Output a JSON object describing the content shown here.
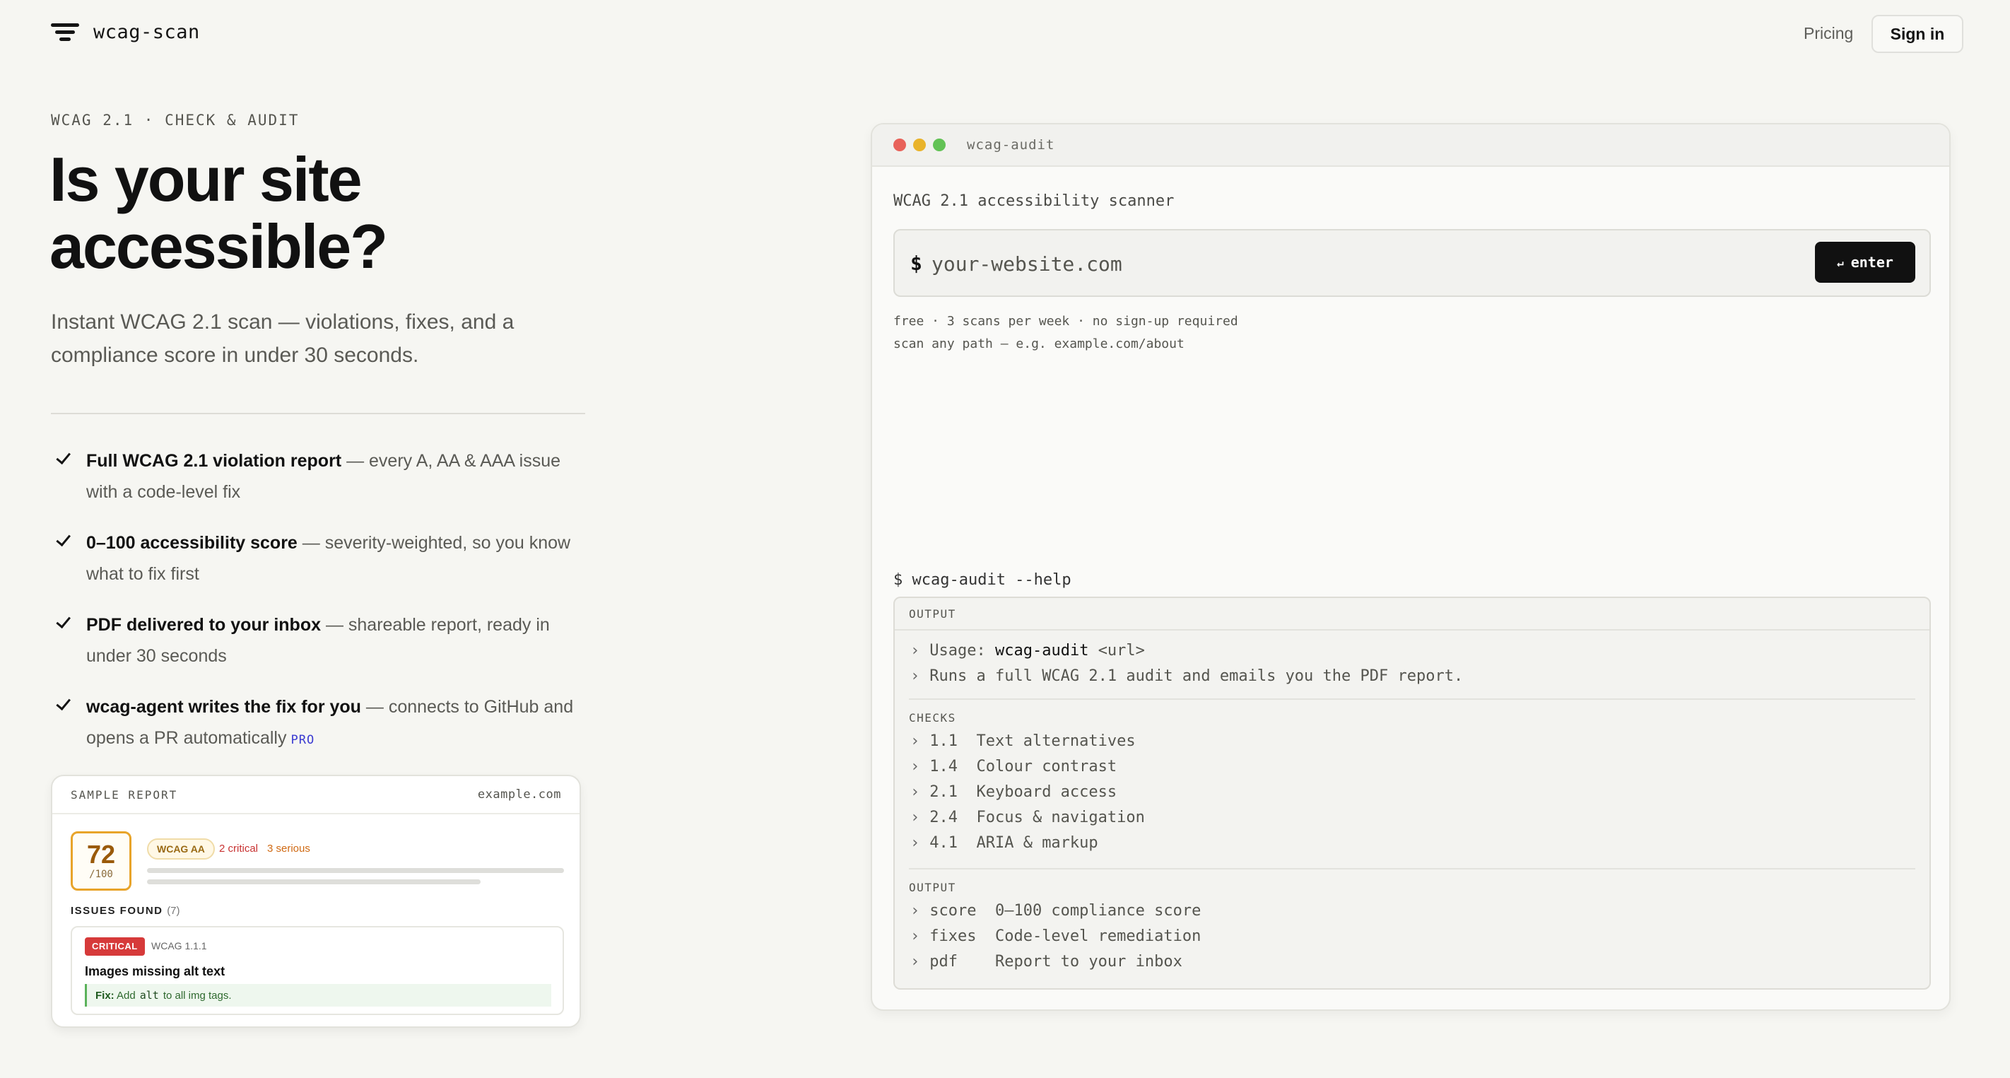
{
  "nav": {
    "brand": "wcag-scan",
    "pricing": "Pricing",
    "signin": "Sign in"
  },
  "hero": {
    "eyebrow": "WCAG 2.1 · CHECK & AUDIT",
    "title_line1": "Is your site",
    "title_line2": "accessible?",
    "subtitle": "Instant WCAG 2.1 scan — violations, fixes, and a compliance score in under 30 seconds."
  },
  "features": [
    {
      "bold": "Full WCAG 2.1 violation report",
      "rest": " — every A, AA & AAA issue with a code-level fix"
    },
    {
      "bold": "0–100 accessibility score",
      "rest": " — severity-weighted, so you know what to fix first"
    },
    {
      "bold": "PDF delivered to your inbox",
      "rest": " — shareable report, ready in under 30 seconds"
    },
    {
      "bold": "wcag-agent writes the fix for you",
      "rest": " — connects to GitHub and opens a PR automatically",
      "badge": "PRO"
    }
  ],
  "report": {
    "label": "SAMPLE REPORT",
    "domain": "example.com",
    "score": "72",
    "score_max": "/100",
    "level": "WCAG AA",
    "critical": "2 critical",
    "serious": "3 serious",
    "issues_label": "ISSUES FOUND",
    "issues_count": "(7)",
    "issue": {
      "severity": "CRITICAL",
      "ref": "WCAG 1.1.1",
      "title": "Images missing alt text",
      "fix_label": "Fix:",
      "fix_pre": "Add",
      "fix_code": "alt",
      "fix_post": "to all img tags."
    }
  },
  "terminal": {
    "title": "wcag-audit",
    "heading": "WCAG 2.1 accessibility scanner",
    "prompt": "$",
    "placeholder": "your-website.com",
    "enter_glyph": "↵",
    "enter_label": "enter",
    "note1": "free · 3 scans per week · no sign-up required",
    "note2": "scan any path — e.g. example.com/about",
    "help_cmd": "$ wcag-audit --help",
    "output_label": "OUTPUT",
    "usage_prefix": "Usage:",
    "usage_cmd": "wcag-audit",
    "usage_arg": "<url>",
    "runs": "Runs a full WCAG 2.1 audit and emails you the PDF report.",
    "checks_label": "CHECKS",
    "checks": [
      "1.1  Text alternatives",
      "1.4  Colour contrast",
      "2.1  Keyboard access",
      "2.4  Focus & navigation",
      "4.1  ARIA & markup"
    ],
    "output2_label": "OUTPUT",
    "outputs": [
      "score  0–100 compliance score",
      "fixes  Code-level remediation",
      "pdf    Report to your inbox"
    ]
  },
  "colors": {
    "background": "#f6f6f2",
    "accent_dark": "#111111",
    "critical": "#d63a3a",
    "serious": "#d06a14",
    "score_border": "#e8a42a",
    "pro": "#3a3ad1"
  },
  "icons": [
    "menu-lines-icon",
    "check-icon",
    "window-dots-icon",
    "enter-icon",
    "chevron-right-icon"
  ]
}
